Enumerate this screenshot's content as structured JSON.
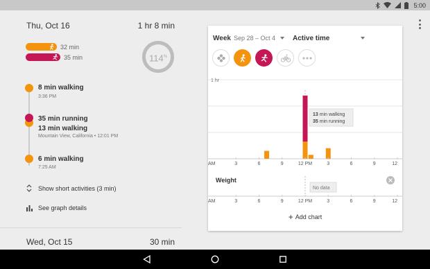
{
  "status_bar": {
    "time": "5:00",
    "icons": [
      "bluetooth-icon",
      "wifi-icon",
      "signal-icon",
      "battery-icon"
    ]
  },
  "left": {
    "day_title": "Thu, Oct 16",
    "day_total": "1 hr 8 min",
    "summary_bars": [
      {
        "label": "32 min",
        "activity": "walking",
        "color": "#f4930e"
      },
      {
        "label": "35 min",
        "activity": "running",
        "color": "#c51755"
      }
    ],
    "gauge": {
      "value": "114",
      "superscript": "%"
    },
    "timeline": [
      {
        "title": "8 min walking",
        "sub": "3:36 PM"
      },
      {
        "title": "35 min running",
        "title2": "13 min walking",
        "sub": "Mountain View, California • 12:01 PM"
      },
      {
        "title": "6 min walking",
        "sub": "7:25 AM"
      }
    ],
    "show_short": "Show short activities (3 min)",
    "graph_details": "See graph details",
    "next_day_title": "Wed, Oct 15",
    "next_day_total": "30 min"
  },
  "card": {
    "period": "Week",
    "range": "Sep 28 – Oct 4",
    "metric": "Active time",
    "y_label": "1 hr",
    "tooltip": {
      "walking": "13",
      "walking_label": "min walking",
      "running": "35",
      "running_label": "min running"
    },
    "weight_label": "Weight",
    "no_data": "No data",
    "add_chart": "Add chart"
  },
  "colors": {
    "walking": "#f4930e",
    "running": "#c51755",
    "gauge": "#bdbdbd"
  },
  "chart_data": {
    "type": "bar",
    "x_tick_labels": [
      "AM",
      "3",
      "6",
      "9",
      "12 PM",
      "3",
      "6",
      "9",
      "12"
    ],
    "x": [
      7,
      12,
      12.75,
      15
    ],
    "series": [
      {
        "name": "walking",
        "values": [
          6,
          13,
          3,
          8
        ]
      },
      {
        "name": "running",
        "values": [
          0,
          35,
          0,
          0
        ]
      }
    ],
    "ylim": [
      0,
      60
    ],
    "grid": true
  }
}
